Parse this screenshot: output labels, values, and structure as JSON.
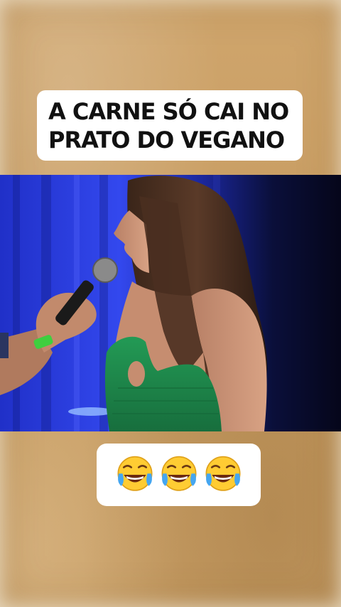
{
  "caption_top": {
    "line1": "A CARNE SÓ CAI NO",
    "line2": "PRATO DO VEGANO"
  },
  "video": {
    "description_icon": "stage-interview-scene"
  },
  "caption_bottom": {
    "emojis": [
      "😂",
      "😂",
      "😂"
    ],
    "emoji_icon": "face-with-tears-of-joy-icon"
  },
  "colors": {
    "background": "#c9a068",
    "caption_bg": "#ffffff",
    "caption_text": "#111111",
    "stage_blue": "#2b3fe0",
    "dress_green": "#1f8a4c"
  }
}
